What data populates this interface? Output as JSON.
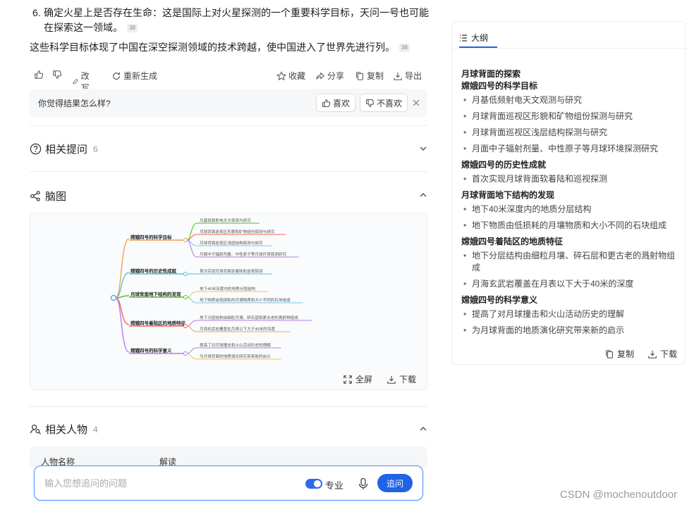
{
  "answer": {
    "item_number": "6.",
    "item_text": "确定火星上是否存在生命：这是国际上对火星探测的一个重要科学目标，天问一号也可能在探索这一领域。",
    "summary": "这些科学目标体现了中国在深空探测领域的技术跨越，使中国进入了世界先进行列。",
    "ref_mark": "38"
  },
  "actions": {
    "rewrite": "改写",
    "regenerate": "重新生成",
    "collect": "收藏",
    "share": "分享",
    "copy": "复制",
    "export": "导出"
  },
  "feedback": {
    "question": "你觉得结果怎么样?",
    "like": "喜欢",
    "dislike": "不喜欢"
  },
  "related_questions": {
    "title": "相关提问",
    "count": "6"
  },
  "mindmap_section": {
    "title": "脑图",
    "fullscreen": "全屏",
    "download": "下载"
  },
  "mindmap": {
    "branches": [
      {
        "label": "嫦娥四号的科学目标",
        "color": "#f0a24b",
        "children": [
          {
            "label": "月基低频射电天文观测与研究",
            "color": "#52c41a"
          },
          {
            "label": "月球背面巡视区形貌和矿物组份探测与研究",
            "color": "#f5635b"
          },
          {
            "label": "月球背面巡视区浅层结构探测与研究",
            "color": "#7dc6f2"
          },
          {
            "label": "月面中子辐射剂量、中性原子等月球环境探测研究",
            "color": "#b37feb"
          }
        ]
      },
      {
        "label": "嫦娥四号的历史性成就",
        "color": "#53c4d8",
        "children": [
          {
            "label": "首次实现月球背面软着陆和巡视探测",
            "color": "#53c4d8"
          }
        ]
      },
      {
        "label": "月球背面地下结构的发现",
        "color": "#52c41a",
        "children": [
          {
            "label": "地下40米深度内的地质分层结构",
            "color": "#f7c844"
          },
          {
            "label": "地下物质由低损耗的月壤物质和大小不同的石块组成",
            "color": "#7dc6f2"
          }
        ]
      },
      {
        "label": "嫦娥四号着陆区的地质特征",
        "color": "#f5635b",
        "children": [
          {
            "label": "地下分层结构由细粒月壤、碎石层和更古老的溅射物组成",
            "color": "#b37feb"
          },
          {
            "label": "月海玄武岩覆盖在月表以下大于40米的深度",
            "color": "#f5a04b"
          }
        ]
      },
      {
        "label": "嫦娥四号的科学意义",
        "color": "#b37feb",
        "children": [
          {
            "label": "提高了对月球撞击和火山活动历史的理解",
            "color": "#b37feb"
          },
          {
            "label": "为月球背面的地质演化研究带来新的启示",
            "color": "#f7c844"
          }
        ]
      }
    ]
  },
  "related_people": {
    "title": "相关人物",
    "count": "4",
    "col_name": "人物名称",
    "col_desc": "解读"
  },
  "input": {
    "placeholder": "输入您想追问的问题",
    "pro_label": "专业",
    "ask_button": "追问"
  },
  "outline": {
    "tab": "大纲",
    "items": [
      {
        "type": "h",
        "text": "月球背面的探索"
      },
      {
        "type": "h",
        "text": "嫦娥四号的科学目标"
      },
      {
        "type": "b",
        "text": "月基低频射电天文观测与研究"
      },
      {
        "type": "b",
        "text": "月球背面巡视区形貌和矿物组份探测与研究"
      },
      {
        "type": "b",
        "text": "月球背面巡视区浅层结构探测与研究"
      },
      {
        "type": "b",
        "text": "月面中子辐射剂量、中性原子等月球环境探测研究"
      },
      {
        "type": "h",
        "text": "嫦娥四号的历史性成就"
      },
      {
        "type": "b",
        "text": "首次实现月球背面软着陆和巡视探测"
      },
      {
        "type": "h",
        "text": "月球背面地下结构的发现"
      },
      {
        "type": "b",
        "text": "地下40米深度内的地质分层结构"
      },
      {
        "type": "b",
        "text": "地下物质由低损耗的月壤物质和大小不同的石块组成"
      },
      {
        "type": "h",
        "text": "嫦娥四号着陆区的地质特征"
      },
      {
        "type": "b",
        "text": "地下分层结构由细粒月壤、碎石层和更古老的溅射物组成"
      },
      {
        "type": "b",
        "text": "月海玄武岩覆盖在月表以下大于40米的深度"
      },
      {
        "type": "h",
        "text": "嫦娥四号的科学意义"
      },
      {
        "type": "b",
        "text": "提高了对月球撞击和火山活动历史的理解"
      },
      {
        "type": "b",
        "text": "为月球背面的地质演化研究带来新的启示"
      }
    ],
    "copy": "复制",
    "download": "下载"
  },
  "watermark": "CSDN @mochenoutdoor"
}
